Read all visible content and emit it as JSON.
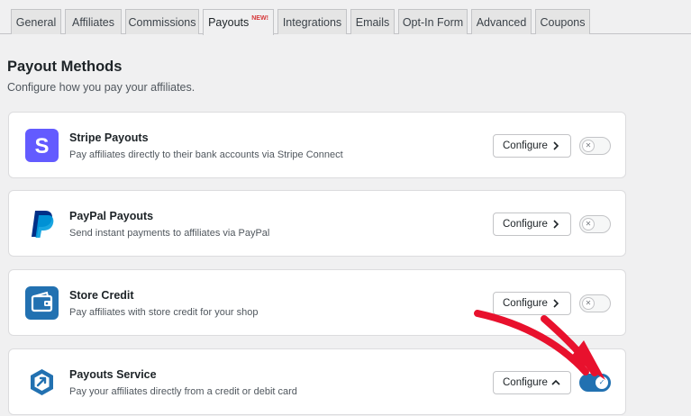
{
  "tabs": [
    {
      "label": "General"
    },
    {
      "label": "Affiliates"
    },
    {
      "label": "Commissions"
    },
    {
      "label": "Payouts",
      "badge": "NEW!"
    },
    {
      "label": "Integrations"
    },
    {
      "label": "Emails"
    },
    {
      "label": "Opt-In Form"
    },
    {
      "label": "Advanced"
    },
    {
      "label": "Coupons"
    }
  ],
  "active_tab": "Payouts",
  "page": {
    "title": "Payout Methods",
    "subtitle": "Configure how you pay your affiliates."
  },
  "methods": [
    {
      "name": "Stripe Payouts",
      "description": "Pay affiliates directly to their bank accounts via Stripe Connect",
      "configure_label": "Configure",
      "enabled": false,
      "icon": "stripe-icon",
      "configure_expanded": false
    },
    {
      "name": "PayPal Payouts",
      "description": "Send instant payments to affiliates via PayPal",
      "configure_label": "Configure",
      "enabled": false,
      "icon": "paypal-icon",
      "configure_expanded": false
    },
    {
      "name": "Store Credit",
      "description": "Pay affiliates with store credit for your shop",
      "configure_label": "Configure",
      "enabled": false,
      "icon": "wallet-icon",
      "configure_expanded": false
    },
    {
      "name": "Payouts Service",
      "description": "Pay your affiliates directly from a credit or debit card",
      "configure_label": "Configure",
      "enabled": true,
      "icon": "payouts-service-icon",
      "configure_expanded": true
    }
  ],
  "colors": {
    "stripe": "#635bff",
    "paypal_dark": "#003087",
    "paypal_light": "#009cde",
    "wallet": "#2271b1",
    "toggle_on": "#2271b1",
    "annotation_arrow": "#e8112d",
    "new_badge": "#d63638"
  }
}
